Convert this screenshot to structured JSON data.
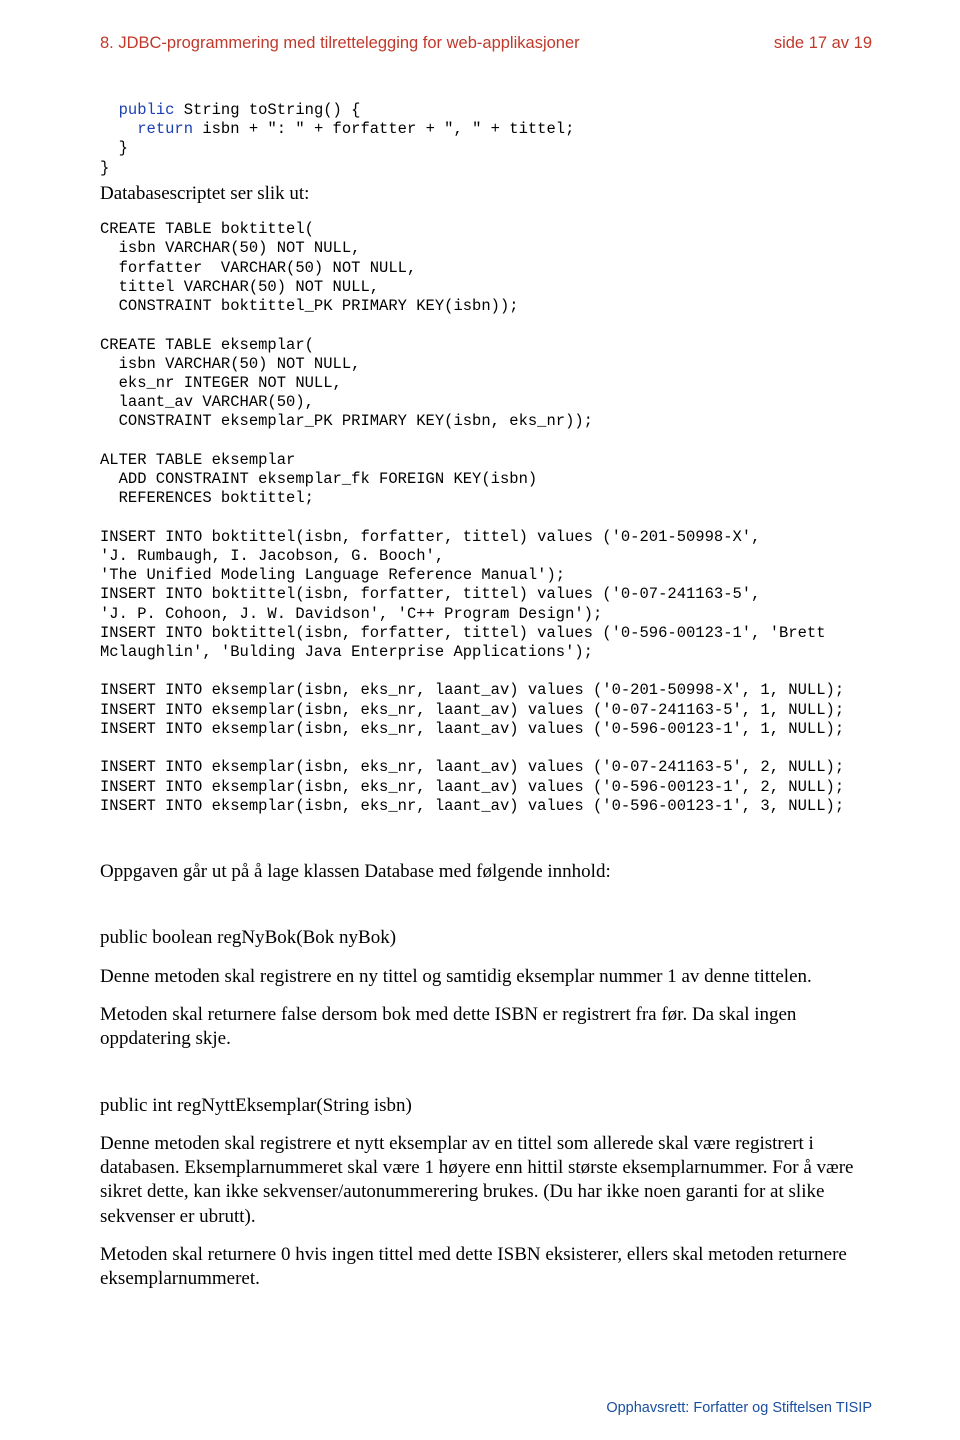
{
  "header": {
    "left": "8. JDBC-programmering med tilrettelegging for web-applikasjoner",
    "right": "side 17 av 19"
  },
  "code1_line1": "  public String toString() {",
  "code1_line2": "    return isbn + \": \" + forfatter + \", \" + tittel;",
  "code1_line3": "  }",
  "code1_line4": "}",
  "intro_line": "Databasescriptet ser slik ut:",
  "sql_block": "CREATE TABLE boktittel(\n  isbn VARCHAR(50) NOT NULL,\n  forfatter  VARCHAR(50) NOT NULL,\n  tittel VARCHAR(50) NOT NULL,\n  CONSTRAINT boktittel_PK PRIMARY KEY(isbn));\n\nCREATE TABLE eksemplar(\n  isbn VARCHAR(50) NOT NULL,\n  eks_nr INTEGER NOT NULL,\n  laant_av VARCHAR(50),\n  CONSTRAINT eksemplar_PK PRIMARY KEY(isbn, eks_nr));\n\nALTER TABLE eksemplar\n  ADD CONSTRAINT eksemplar_fk FOREIGN KEY(isbn)\n  REFERENCES boktittel;\n\nINSERT INTO boktittel(isbn, forfatter, tittel) values ('0-201-50998-X',\n'J. Rumbaugh, I. Jacobson, G. Booch',\n'The Unified Modeling Language Reference Manual');\nINSERT INTO boktittel(isbn, forfatter, tittel) values ('0-07-241163-5',\n'J. P. Cohoon, J. W. Davidson', 'C++ Program Design');\nINSERT INTO boktittel(isbn, forfatter, tittel) values ('0-596-00123-1', 'Brett\nMclaughlin', 'Bulding Java Enterprise Applications');\n\nINSERT INTO eksemplar(isbn, eks_nr, laant_av) values ('0-201-50998-X', 1, NULL);\nINSERT INTO eksemplar(isbn, eks_nr, laant_av) values ('0-07-241163-5', 1, NULL);\nINSERT INTO eksemplar(isbn, eks_nr, laant_av) values ('0-596-00123-1', 1, NULL);\n\nINSERT INTO eksemplar(isbn, eks_nr, laant_av) values ('0-07-241163-5', 2, NULL);\nINSERT INTO eksemplar(isbn, eks_nr, laant_av) values ('0-596-00123-1', 2, NULL);\nINSERT INTO eksemplar(isbn, eks_nr, laant_av) values ('0-596-00123-1', 3, NULL);",
  "para1": "Oppgaven går ut på å lage klassen Database med følgende innhold:",
  "sig1": "public boolean regNyBok(Bok nyBok)",
  "para2": "Denne metoden skal registrere en ny tittel og samtidig eksemplar nummer 1 av denne tittelen.",
  "para3": "Metoden skal returnere false dersom bok med dette ISBN er registrert fra før. Da skal ingen oppdatering skje.",
  "sig2": "public int regNyttEksemplar(String isbn)",
  "para4": "Denne metoden skal registrere et nytt eksemplar av en tittel som allerede skal være registrert i databasen. Eksemplarnummeret skal være 1 høyere enn hittil største eksemplarnummer. For å være sikret dette, kan ikke sekvenser/autonummerering brukes. (Du har ikke noen garanti for at slike sekvenser er ubrutt).",
  "para5": "Metoden skal returnere 0 hvis ingen tittel med dette ISBN eksisterer, ellers skal metoden returnere eksemplarnummeret.",
  "footer": "Opphavsrett:  Forfatter og Stiftelsen TISIP"
}
